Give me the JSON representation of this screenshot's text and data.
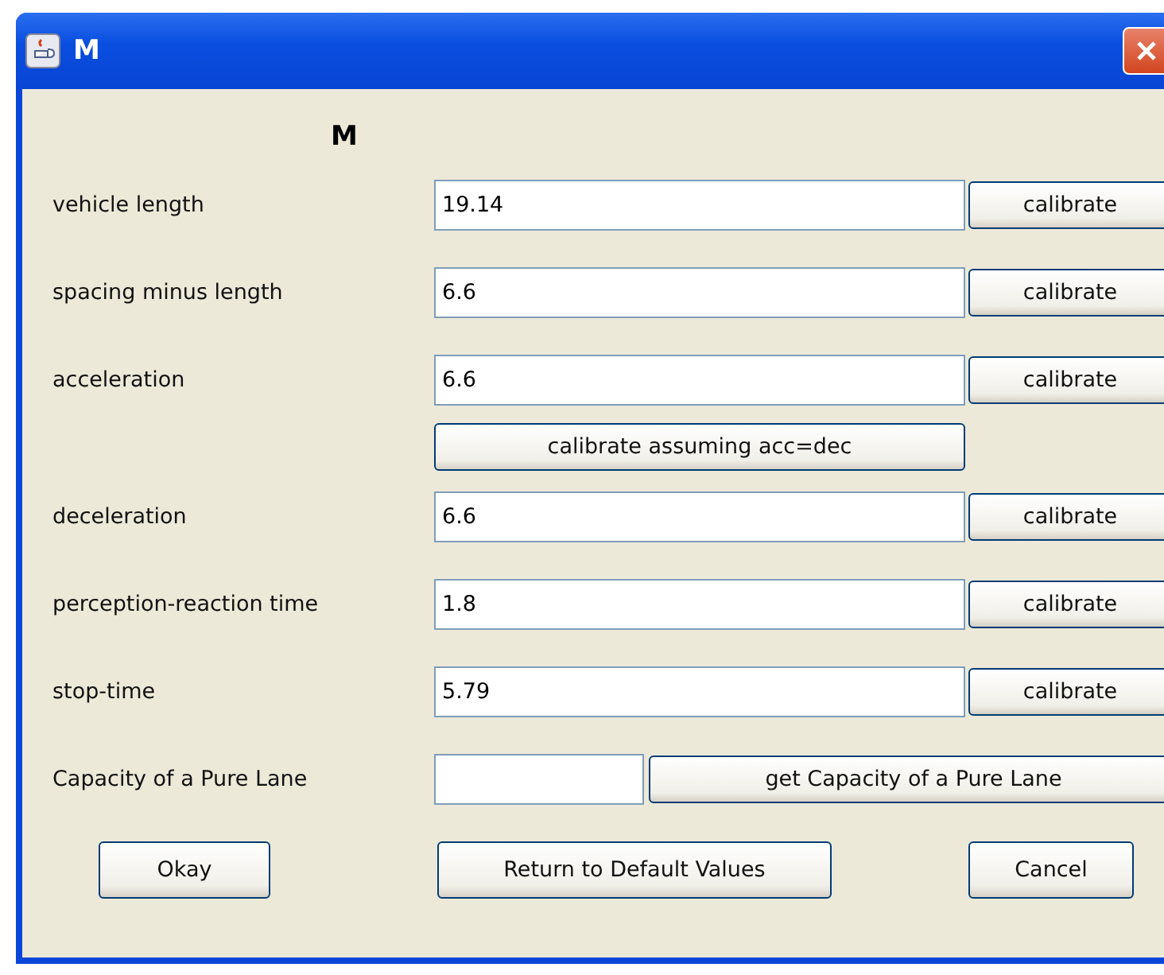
{
  "window": {
    "title": "M"
  },
  "heading": "M",
  "parameters": [
    {
      "label": "vehicle length",
      "value": "19.14",
      "button": "calibrate"
    },
    {
      "label": "spacing minus length",
      "value": "6.6",
      "button": "calibrate"
    },
    {
      "label": "acceleration",
      "value": "6.6",
      "button": "calibrate"
    },
    {
      "kind": "wide-button",
      "button": "calibrate assuming acc=dec"
    },
    {
      "label": "deceleration",
      "value": "6.6",
      "button": "calibrate"
    },
    {
      "label": "perception-reaction time",
      "value": "1.8",
      "button": "calibrate"
    },
    {
      "label": "stop-time",
      "value": "5.79",
      "button": "calibrate"
    }
  ],
  "capacity": {
    "label": "Capacity of a Pure Lane",
    "button": "get Capacity of a Pure Lane"
  },
  "buttons": [
    "Okay",
    "Return to Default Values",
    "Cancel"
  ]
}
